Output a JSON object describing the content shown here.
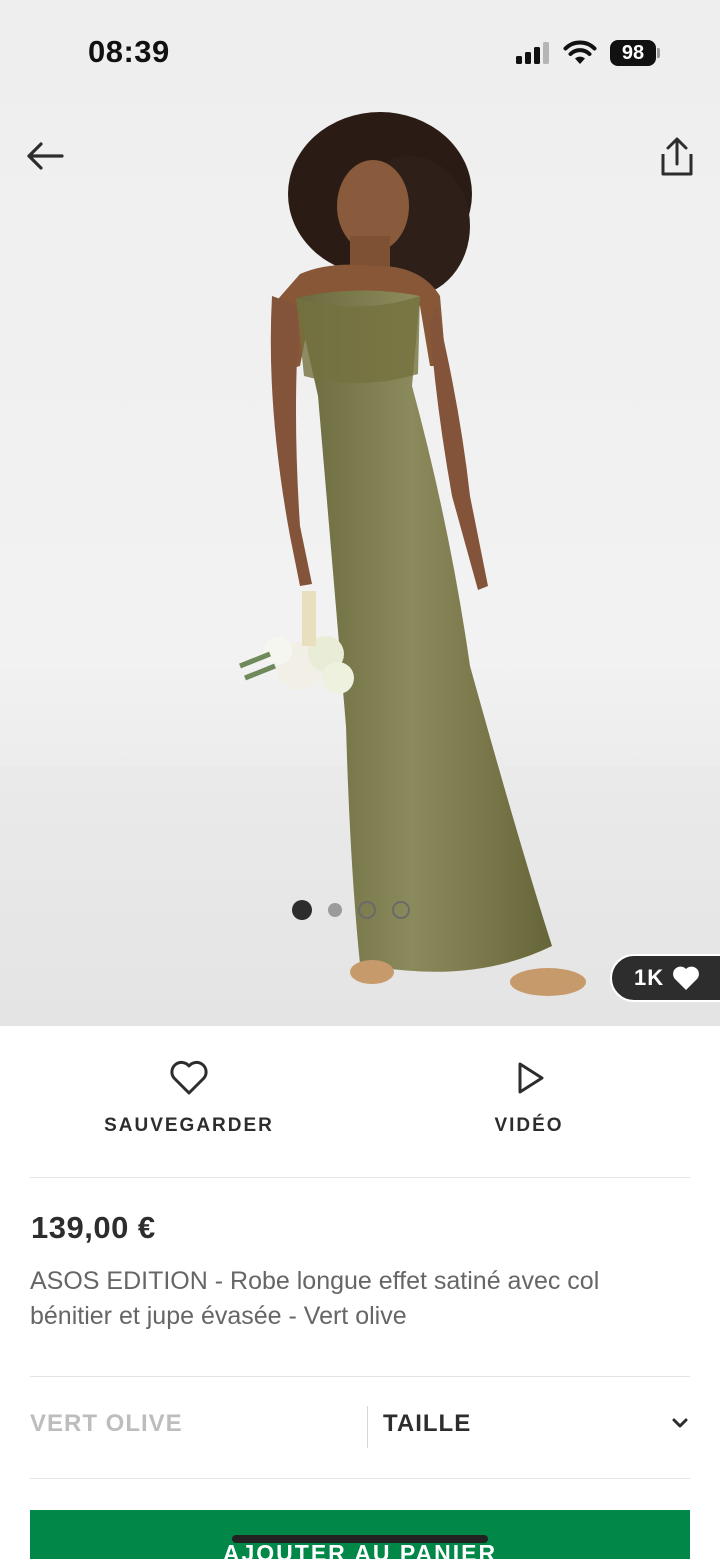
{
  "status_bar": {
    "time": "08:39",
    "battery": "98",
    "icons": [
      "cellular-signal-icon",
      "wifi-icon",
      "battery-icon"
    ]
  },
  "header": {
    "back_icon": "arrow-left-icon",
    "share_icon": "share-icon"
  },
  "gallery": {
    "image_count": 4,
    "active_index": 0,
    "likes": "1K",
    "likes_icon": "heart-filled-icon"
  },
  "actions": {
    "save_label": "SAUVEGARDER",
    "save_icon": "heart-outline-icon",
    "video_label": "VIDÉO",
    "video_icon": "play-icon"
  },
  "product": {
    "price": "139,00 €",
    "title": "ASOS EDITION - Robe longue effet satiné avec col bénitier et jupe évasée - Vert olive"
  },
  "options": {
    "color": "VERT OLIVE",
    "size_label": "TAILLE",
    "size_icon": "chevron-down-icon"
  },
  "cta": {
    "add_to_cart": "AJOUTER AU PANIER",
    "color": "#018849"
  },
  "colors": {
    "text": "#2d2d2d",
    "muted": "#666666",
    "dress": "#7d7a4e"
  }
}
